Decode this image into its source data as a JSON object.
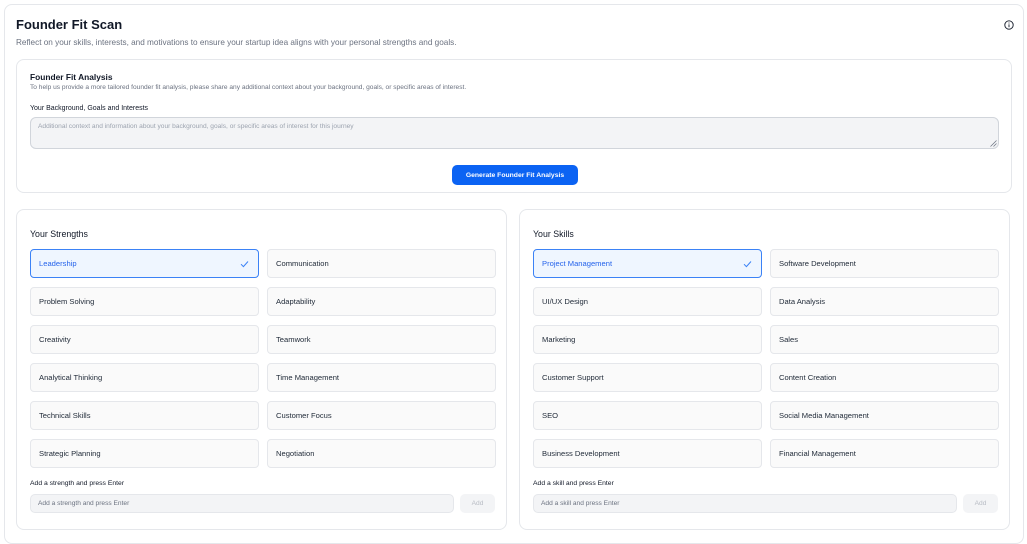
{
  "header": {
    "title": "Founder Fit Scan",
    "subtitle": "Reflect on your skills, interests, and motivations to ensure your startup idea aligns with your personal strengths and goals.",
    "info_icon": "info-circle-icon"
  },
  "analysis": {
    "title": "Founder Fit Analysis",
    "description": "To help us provide a more tailored founder fit analysis, please share any additional context about your background, goals, or specific areas of interest.",
    "field_label": "Your Background, Goals and Interests",
    "textarea_value": "",
    "textarea_placeholder": "Additional context and information about your background, goals, or specific areas of interest for this journey",
    "generate_label": "Generate Founder Fit Analysis"
  },
  "strengths": {
    "title": "Your Strengths",
    "items": [
      {
        "label": "Leadership",
        "selected": true
      },
      {
        "label": "Communication",
        "selected": false
      },
      {
        "label": "Problem Solving",
        "selected": false
      },
      {
        "label": "Adaptability",
        "selected": false
      },
      {
        "label": "Creativity",
        "selected": false
      },
      {
        "label": "Teamwork",
        "selected": false
      },
      {
        "label": "Analytical Thinking",
        "selected": false
      },
      {
        "label": "Time Management",
        "selected": false
      },
      {
        "label": "Technical Skills",
        "selected": false
      },
      {
        "label": "Customer Focus",
        "selected": false
      },
      {
        "label": "Strategic Planning",
        "selected": false
      },
      {
        "label": "Negotiation",
        "selected": false
      }
    ],
    "add_label": "Add a strength and press Enter",
    "add_placeholder": "Add a strength and press Enter",
    "add_button": "Add"
  },
  "skills": {
    "title": "Your Skills",
    "items": [
      {
        "label": "Project Management",
        "selected": true
      },
      {
        "label": "Software Development",
        "selected": false
      },
      {
        "label": "UI/UX Design",
        "selected": false
      },
      {
        "label": "Data Analysis",
        "selected": false
      },
      {
        "label": "Marketing",
        "selected": false
      },
      {
        "label": "Sales",
        "selected": false
      },
      {
        "label": "Customer Support",
        "selected": false
      },
      {
        "label": "Content Creation",
        "selected": false
      },
      {
        "label": "SEO",
        "selected": false
      },
      {
        "label": "Social Media Management",
        "selected": false
      },
      {
        "label": "Business Development",
        "selected": false
      },
      {
        "label": "Financial Management",
        "selected": false
      }
    ],
    "add_label": "Add a skill and press Enter",
    "add_placeholder": "Add a skill and press Enter",
    "add_button": "Add"
  },
  "colors": {
    "accent": "#0b63f3",
    "selected_border": "#3b82f6",
    "selected_bg": "#eff6ff"
  }
}
